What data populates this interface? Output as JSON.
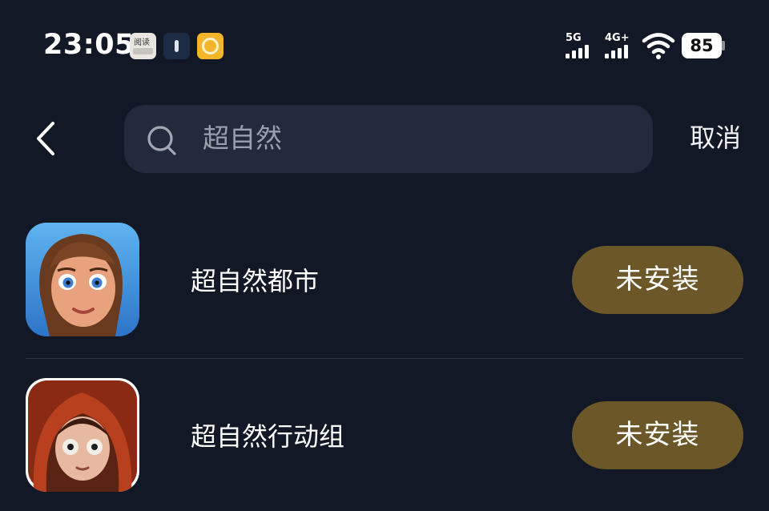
{
  "status_bar": {
    "time": "23:05",
    "notification_icons": [
      "read-app-icon",
      "phone-app-icon",
      "hand-app-icon"
    ],
    "notification_read_text": "阅读",
    "signal_1_label": "5G",
    "signal_2_label": "4G+",
    "battery_level": "85"
  },
  "header": {
    "search_query": "超自然",
    "cancel_label": "取消"
  },
  "results": [
    {
      "name": "超自然都市",
      "status": "未安装"
    },
    {
      "name": "超自然行动组",
      "status": "未安装"
    }
  ],
  "colors": {
    "background": "#131827",
    "search_box": "#232a3b",
    "status_pill": "#6b5727"
  }
}
